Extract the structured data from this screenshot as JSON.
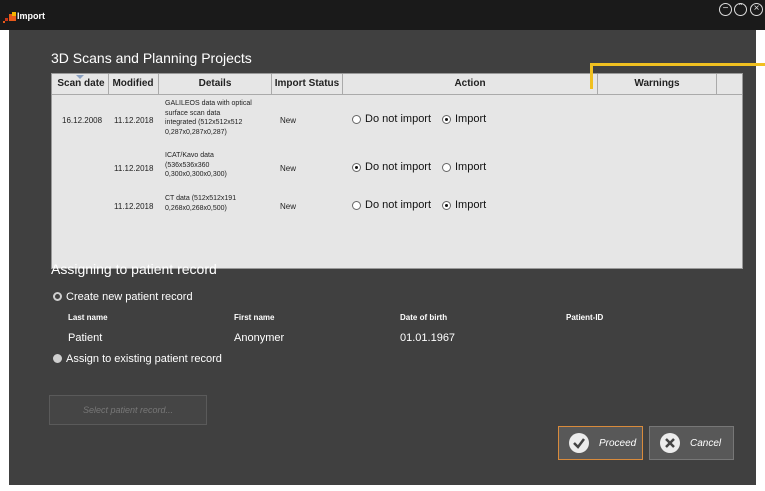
{
  "window": {
    "title": "Import",
    "controls": [
      "minimize",
      "maximize",
      "close"
    ]
  },
  "colors": {
    "background": "#404040",
    "titlebar": "#1a1a1a",
    "table_bg": "#e6e6e6",
    "accent_yellow": "#f0c020",
    "proceed_border": "#d98b3c"
  },
  "scans": {
    "title": "3D Scans and Planning Projects",
    "columns": [
      "Scan date",
      "Modified",
      "Details",
      "Import Status",
      "Action",
      "Warnings"
    ],
    "rows": [
      {
        "scan_date": "16.12.2008",
        "modified": "11.12.2018",
        "details": [
          "GALILEOS data with optical",
          "surface scan data",
          "integrated (512x512x512",
          "0,287x0,287x0,287)"
        ],
        "status": "New",
        "action": "import",
        "opt_no": "Do not import",
        "opt_yes": "Import"
      },
      {
        "scan_date": "",
        "modified": "11.12.2018",
        "details": [
          "ICAT/Kavo data",
          "(536x536x360",
          "0,300x0,300x0,300)"
        ],
        "status": "New",
        "action": "do-not-import",
        "opt_no": "Do not import",
        "opt_yes": "Import"
      },
      {
        "scan_date": "",
        "modified": "11.12.2018",
        "details": [
          "CT data (512x512x191",
          "0,268x0,268x0,500)"
        ],
        "status": "New",
        "action": "import",
        "opt_no": "Do not import",
        "opt_yes": "Import"
      }
    ]
  },
  "patient": {
    "title": "Assigning to patient record",
    "create_label": "Create new patient record",
    "assign_label": "Assign to existing patient record",
    "selected": "create",
    "headers": {
      "last_name": "Last name",
      "first_name": "First name",
      "dob": "Date of birth",
      "pid": "Patient-ID"
    },
    "values": {
      "last_name": "Patient",
      "first_name": "Anonymer",
      "dob": "01.01.1967",
      "pid": ""
    },
    "select_button": "Select patient record..."
  },
  "buttons": {
    "proceed": "Proceed",
    "cancel": "Cancel"
  }
}
